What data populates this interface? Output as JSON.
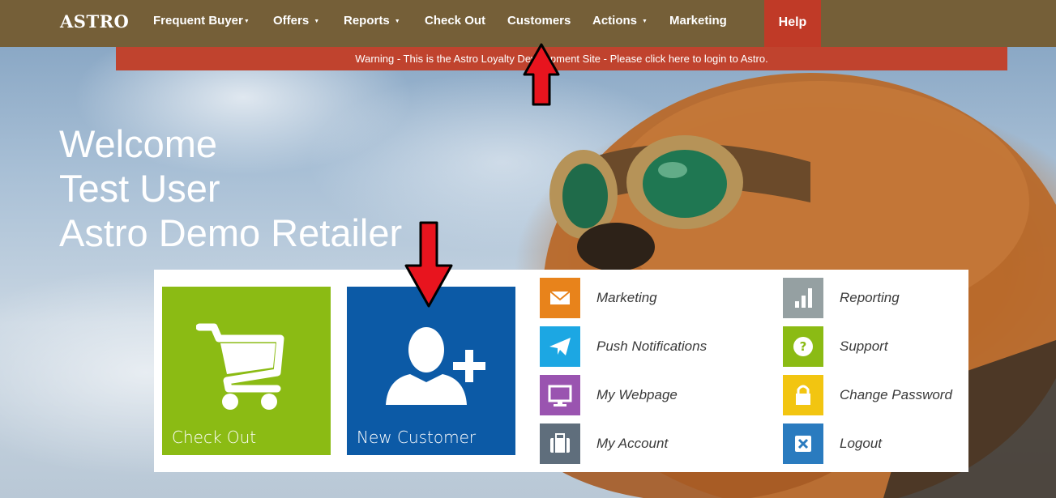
{
  "navbar": {
    "brand": "ASTRO",
    "items": [
      {
        "label": "Frequent Buyer",
        "dropdown": true
      },
      {
        "label": "Offers",
        "dropdown": true
      },
      {
        "label": "Reports",
        "dropdown": true
      },
      {
        "label": "Check Out",
        "dropdown": false
      },
      {
        "label": "Customers",
        "dropdown": false
      },
      {
        "label": "Actions",
        "dropdown": true
      },
      {
        "label": "Marketing",
        "dropdown": false
      }
    ],
    "help": "Help",
    "caret": "▼"
  },
  "warning": "Warning - This is the Astro Loyalty Development Site - Please click here to login to Astro.",
  "welcome": {
    "line1": "Welcome",
    "line2": "Test User",
    "line3": "Astro Demo Retailer"
  },
  "tiles": {
    "checkout": {
      "label": "Check Out",
      "icon": "shopping-cart-icon",
      "color": "#8bbb14"
    },
    "new_customer": {
      "label": "New Customer",
      "icon": "add-user-icon",
      "color": "#0c5aa6"
    }
  },
  "links": [
    {
      "label": "Marketing",
      "icon": "envelope-icon",
      "color": "#e8831b"
    },
    {
      "label": "Push Notifications",
      "icon": "paper-plane-icon",
      "color": "#1ca7e3"
    },
    {
      "label": "My Webpage",
      "icon": "monitor-icon",
      "color": "#9a54b0"
    },
    {
      "label": "My Account",
      "icon": "briefcase-icon",
      "color": "#5f6e7c"
    },
    {
      "label": "Reporting",
      "icon": "bar-chart-icon",
      "color": "#95a0a2"
    },
    {
      "label": "Support",
      "icon": "question-icon",
      "color": "#8bbb14"
    },
    {
      "label": "Change Password",
      "icon": "lock-icon",
      "color": "#f2c511"
    },
    {
      "label": "Logout",
      "icon": "close-box-icon",
      "color": "#2a7bbf"
    }
  ],
  "colors": {
    "navbar": "#755f38",
    "help": "#c03a27",
    "warning": "#c0432e",
    "annotation_arrow": "#e8141e"
  }
}
